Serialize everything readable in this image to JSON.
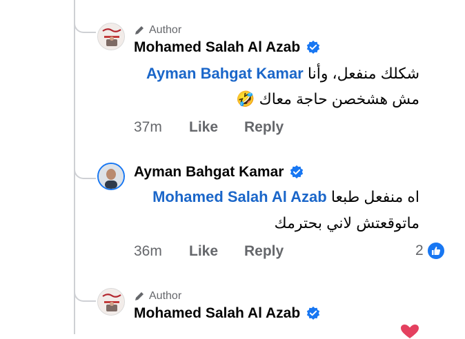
{
  "colors": {
    "verified": "#1877f2",
    "mention": "#1a66c9",
    "muted": "#65676b",
    "thread_line": "#ced0d4",
    "like_reaction": "#1877f2",
    "heart": "#e4405f"
  },
  "comments": [
    {
      "avatar_icon": "profile-photo",
      "author_badge": "Author",
      "author_badge_icon": "pencil-icon",
      "name": "Mohamed Salah Al Azab",
      "verified_icon": "verified-badge-icon",
      "line1_mention": "Ayman Bahgat Kamar",
      "line1_text": "شكلك منفعل، وأنا",
      "line2_text": "مش هشخصن حاجة معاك",
      "line2_emoji": "🤣",
      "time": "37m",
      "like_label": "Like",
      "reply_label": "Reply"
    },
    {
      "avatar_icon": "profile-photo",
      "name": "Ayman Bahgat Kamar",
      "verified_icon": "verified-badge-icon",
      "line1_mention": "Mohamed Salah Al Azab",
      "line1_text": "اه منفعل طبعا",
      "line2_text": "ماتوقعتش لاني بحترمك",
      "time": "36m",
      "like_label": "Like",
      "reply_label": "Reply",
      "reaction_count": "2",
      "reaction_icon": "like-reaction-icon"
    },
    {
      "avatar_icon": "profile-photo",
      "author_badge": "Author",
      "author_badge_icon": "pencil-icon",
      "name": "Mohamed Salah Al Azab",
      "verified_icon": "verified-badge-icon",
      "partial_emoji_icon": "heart-icon"
    }
  ]
}
